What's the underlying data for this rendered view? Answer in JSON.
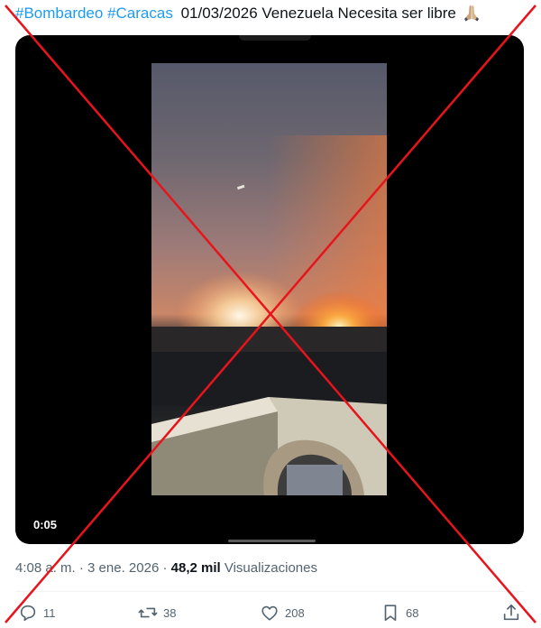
{
  "tweet": {
    "hashtag1": "#Bombardeo",
    "hashtag2": "#Caracas",
    "text": "01/03/2026 Venezuela Necesita ser libre"
  },
  "video": {
    "elapsed": "0:05"
  },
  "meta": {
    "time": "4:08 a. m.",
    "separator1": "·",
    "date": "3 ene. 2026",
    "separator2": "·",
    "views_count": "48,2 mil",
    "views_label": "Visualizaciones"
  },
  "actions": {
    "replies": "11",
    "reposts": "38",
    "likes": "208",
    "bookmarks": "68"
  },
  "icons": {
    "emoji": "folded-hands-icon",
    "reply": "reply-icon",
    "repost": "repost-icon",
    "like": "heart-icon",
    "bookmark": "bookmark-icon",
    "share": "share-icon"
  },
  "colors": {
    "hashtag": "#1d9bf0",
    "overlay_cross": "#e8141c",
    "muted_text": "#536471"
  }
}
